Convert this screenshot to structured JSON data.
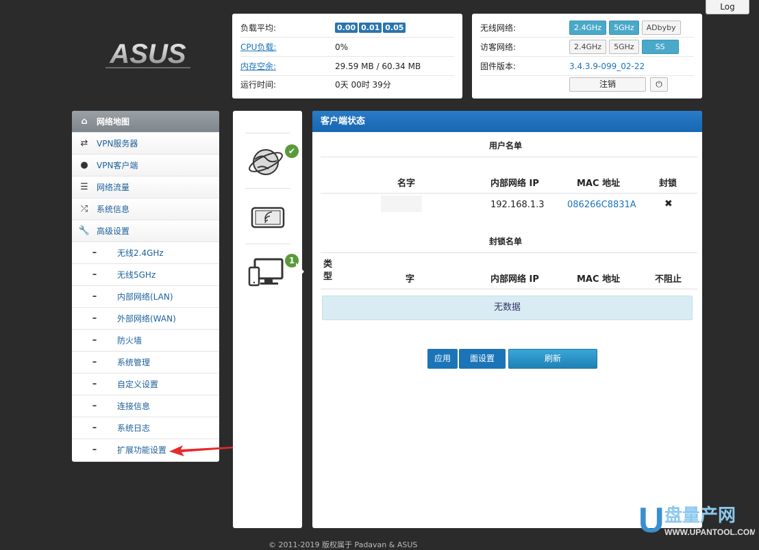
{
  "header": {
    "log_label": "Log",
    "logo_text": "ASUS"
  },
  "status": {
    "load_label": "负载平均:",
    "load_values": [
      "0.00",
      "0.01",
      "0.05"
    ],
    "cpu_label": "CPU负载:",
    "cpu_value": "0%",
    "mem_label": "内存空余:",
    "mem_value": "29.59 MB / 60.34 MB",
    "uptime_label": "运行时间:",
    "uptime_value": "0天 00时 39分"
  },
  "network": {
    "wireless_label": "无线网络:",
    "wireless_buttons": [
      "2.4GHz",
      "5GHz",
      "ADbyby"
    ],
    "guest_label": "访客网络:",
    "guest_buttons": [
      "2.4GHz",
      "5GHz",
      "SS"
    ],
    "firmware_label": "固件版本:",
    "firmware_value": "3.4.3.9-099_02-22",
    "logout_label": "注销"
  },
  "menu": {
    "items": [
      {
        "label": "网络地图",
        "icon": "home-icon"
      },
      {
        "label": "VPN服务器",
        "icon": "repeat-icon"
      },
      {
        "label": "VPN客户端",
        "icon": "globe-icon"
      },
      {
        "label": "网络流量",
        "icon": "list-icon"
      },
      {
        "label": "系统信息",
        "icon": "shuffle-icon"
      },
      {
        "label": "高级设置",
        "icon": "wrench-icon"
      }
    ],
    "sub_items": [
      "无线2.4GHz",
      "无线5GHz",
      "内部网络(LAN)",
      "外部网络(WAN)",
      "防火墙",
      "系统管理",
      "自定义设置",
      "连接信息",
      "系统日志",
      "扩展功能设置"
    ]
  },
  "devices": {
    "internet_badge": "✔",
    "clients_badge": "1"
  },
  "main": {
    "title": "客户端状态",
    "user_list_title": "用户名单",
    "user_headers": [
      "名字",
      "内部网络 IP",
      "MAC 地址",
      "封锁"
    ],
    "user_rows": [
      {
        "ip": "192.168.1.3",
        "mac": "086266C8831A",
        "block": "✖"
      }
    ],
    "block_list_title": "封锁名单",
    "block_headers": [
      "类型",
      "字",
      "内部网络 IP",
      "MAC 地址",
      "不阻止"
    ],
    "no_data": "无数据",
    "apply_label": "应用",
    "page_setting_label": "面设置",
    "refresh_label": "刷新"
  },
  "watermark": {
    "letter": "U",
    "name": "盘量产网",
    "url": "WWW.UPANTOOL.COM"
  },
  "footer": {
    "text": "© 2011-2019 版权属于 Padavan & ASUS"
  },
  "colors": {
    "accent_blue": "#1a74ba",
    "title_bar": "#1766b1",
    "active_pill": "#4aa8c9"
  }
}
